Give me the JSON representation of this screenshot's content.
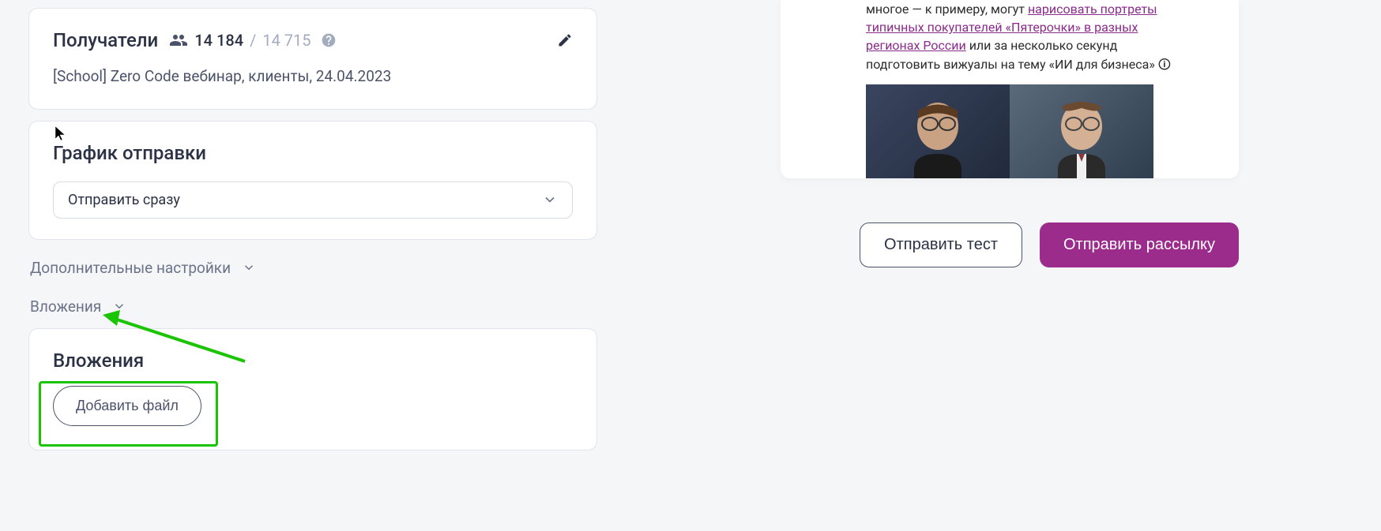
{
  "recipients": {
    "title": "Получатели",
    "count_active": "14 184",
    "count_total": "14 715",
    "list_name": "[School] Zero Code вебинар, клиенты, 24.04.2023"
  },
  "schedule": {
    "title": "График отправки",
    "selected_option": "Отправить сразу"
  },
  "collapsibles": {
    "advanced_settings": "Дополнительные настройки",
    "attachments": "Вложения"
  },
  "attachments_panel": {
    "title": "Вложения",
    "add_file_button": "Добавить файл"
  },
  "preview": {
    "text_part1": "многое — к примеру, могут ",
    "link1": "нарисовать портреты типичных покупателей «Пятерочки» в разных регионах России",
    "text_part2": " или за несколько секунд подготовить вижуалы на тему «ИИ для бизнеса» 🛈"
  },
  "actions": {
    "send_test": "Отправить тест",
    "send_campaign": "Отправить рассылку"
  }
}
